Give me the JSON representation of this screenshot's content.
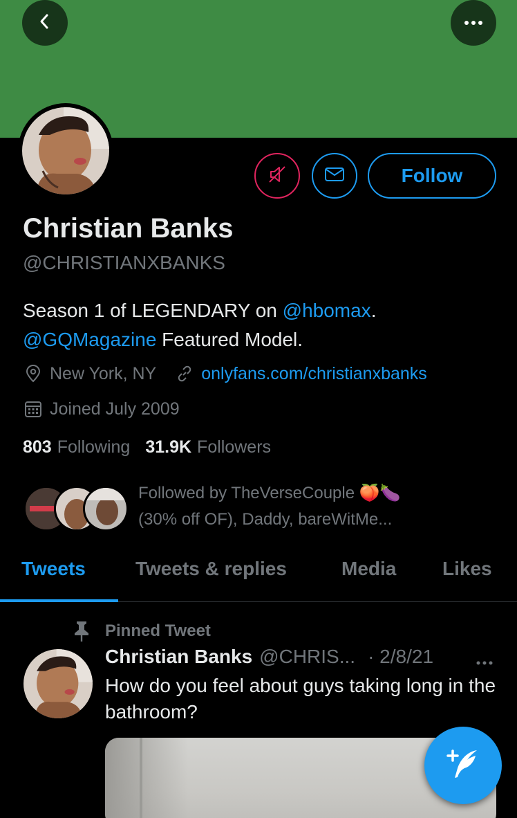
{
  "profile": {
    "name": "Christian Banks",
    "handle": "@CHRISTIANXBANKS",
    "follow_label": "Follow",
    "bio": {
      "line1_prefix": "Season 1 of LEGENDARY on ",
      "line1_mention": "@hbomax",
      "line1_suffix": ".",
      "line2_mention": "@GQMagazine",
      "line2_suffix": " Featured Model."
    },
    "location": "New York, NY",
    "website": "onlyfans.com/christianxbanks",
    "joined": "Joined July 2009",
    "following_count": "803",
    "following_label": "Following",
    "followers_count": "31.9K",
    "followers_label": "Followers",
    "followed_by_line1": "Followed by TheVerseCouple 🍑🍆",
    "followed_by_line2": "(30% off OF), Daddy, bareWitMe..."
  },
  "tabs": [
    {
      "label": "Tweets",
      "active": true
    },
    {
      "label": "Tweets & replies",
      "active": false
    },
    {
      "label": "Media",
      "active": false
    },
    {
      "label": "Likes",
      "active": false
    }
  ],
  "tweet": {
    "pinned_label": "Pinned Tweet",
    "author_name": "Christian Banks",
    "author_handle": "@CHRIS...",
    "date": "· 2/8/21",
    "text": "How do you feel about guys taking long in the bathroom?"
  },
  "icons": {
    "back": "chevron-left-icon",
    "more": "ellipsis-icon",
    "mute": "muted-speaker-icon",
    "message": "envelope-icon",
    "location": "location-pin-icon",
    "link": "link-icon",
    "calendar": "calendar-icon",
    "pin": "pin-icon",
    "compose": "feather-plus-icon"
  },
  "colors": {
    "banner": "#3e8b44",
    "accent": "#1d9bf0",
    "mute": "#e0245e",
    "secondary_text": "#71767b"
  }
}
